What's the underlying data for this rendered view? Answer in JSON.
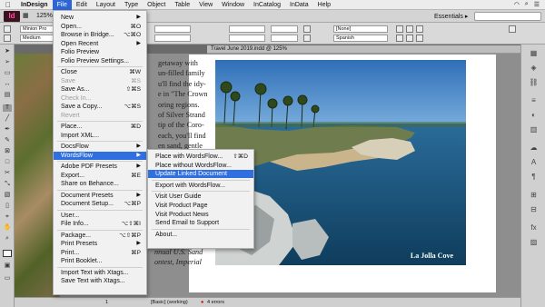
{
  "menubar": {
    "app": "InDesign",
    "items": [
      "File",
      "Edit",
      "Layout",
      "Type",
      "Object",
      "Table",
      "View",
      "Window",
      "InCatalog",
      "InData",
      "Help"
    ]
  },
  "appbar": {
    "logo": "Id",
    "zoom": "125%",
    "workspace": "Essentials ▸",
    "search_icon": "search-icon"
  },
  "control": {
    "font": "Minion Pro",
    "style": "Medium",
    "swatch": "[None]",
    "language": "Spanish"
  },
  "document": {
    "tab_title": "Travel June 2019.indd @ 125%",
    "body_lines": [
      "getaway with",
      "un-filled family",
      "u'll find the idy-",
      "e in \"The Crown",
      "oring regions.",
      "of Silver Strand",
      "tip of the Coro-",
      "each, you'll find",
      "en sand, gentle"
    ],
    "bottom_lines": [
      "nnual U.S. Sand",
      "ontest, Imperial"
    ],
    "photo_caption": "La Jolla Cove"
  },
  "status": {
    "page": "1",
    "preflight": "[Basic] (working)",
    "errors": "4 errors"
  },
  "file_menu": {
    "items": [
      {
        "label": "New",
        "shortcut": "",
        "arrow": true,
        "disabled": false
      },
      {
        "label": "Open...",
        "shortcut": "⌘O",
        "arrow": false,
        "disabled": false
      },
      {
        "label": "Browse in Bridge...",
        "shortcut": "⌥⌘O",
        "arrow": false,
        "disabled": false
      },
      {
        "label": "Open Recent",
        "shortcut": "",
        "arrow": true,
        "disabled": false
      },
      {
        "label": "Folio Preview",
        "shortcut": "",
        "arrow": false,
        "disabled": false
      },
      {
        "label": "Folio Preview Settings...",
        "shortcut": "",
        "arrow": false,
        "disabled": false
      },
      {
        "label": "Close",
        "shortcut": "⌘W",
        "arrow": false,
        "disabled": false
      },
      {
        "label": "Save",
        "shortcut": "⌘S",
        "arrow": false,
        "disabled": true
      },
      {
        "label": "Save As...",
        "shortcut": "⇧⌘S",
        "arrow": false,
        "disabled": false
      },
      {
        "label": "Check In...",
        "shortcut": "",
        "arrow": false,
        "disabled": true
      },
      {
        "label": "Save a Copy...",
        "shortcut": "⌥⌘S",
        "arrow": false,
        "disabled": false
      },
      {
        "label": "Revert",
        "shortcut": "",
        "arrow": false,
        "disabled": true
      },
      {
        "label": "Place...",
        "shortcut": "⌘D",
        "arrow": false,
        "disabled": false
      },
      {
        "label": "Import XML...",
        "shortcut": "",
        "arrow": false,
        "disabled": false
      },
      {
        "label": "DocsFlow",
        "shortcut": "",
        "arrow": true,
        "disabled": false
      },
      {
        "label": "WordsFlow",
        "shortcut": "",
        "arrow": true,
        "disabled": false
      },
      {
        "label": "Adobe PDF Presets",
        "shortcut": "",
        "arrow": true,
        "disabled": false
      },
      {
        "label": "Export...",
        "shortcut": "⌘E",
        "arrow": false,
        "disabled": false
      },
      {
        "label": "Share on Behance...",
        "shortcut": "",
        "arrow": false,
        "disabled": false
      },
      {
        "label": "Document Presets",
        "shortcut": "",
        "arrow": true,
        "disabled": false
      },
      {
        "label": "Document Setup...",
        "shortcut": "⌥⌘P",
        "arrow": false,
        "disabled": false
      },
      {
        "label": "User...",
        "shortcut": "",
        "arrow": false,
        "disabled": false
      },
      {
        "label": "File Info...",
        "shortcut": "⌥⇧⌘I",
        "arrow": false,
        "disabled": false
      },
      {
        "label": "Package...",
        "shortcut": "⌥⇧⌘P",
        "arrow": false,
        "disabled": false
      },
      {
        "label": "Print Presets",
        "shortcut": "",
        "arrow": true,
        "disabled": false
      },
      {
        "label": "Print...",
        "shortcut": "⌘P",
        "arrow": false,
        "disabled": false
      },
      {
        "label": "Print Booklet...",
        "shortcut": "",
        "arrow": false,
        "disabled": false
      },
      {
        "label": "Import Text with Xtags...",
        "shortcut": "",
        "arrow": false,
        "disabled": false
      },
      {
        "label": "Save Text with Xtags...",
        "shortcut": "",
        "arrow": false,
        "disabled": false
      }
    ]
  },
  "wordsflow_menu": {
    "items": [
      {
        "label": "Place with WordsFlow...",
        "shortcut": "⇧⌘D"
      },
      {
        "label": "Place without WordsFlow...",
        "shortcut": ""
      },
      {
        "label": "Update Linked Document",
        "shortcut": ""
      },
      {
        "label": "Export with WordsFlow...",
        "shortcut": ""
      },
      {
        "label": "Visit User Guide",
        "shortcut": ""
      },
      {
        "label": "Visit Product Page",
        "shortcut": ""
      },
      {
        "label": "Visit Product News",
        "shortcut": ""
      },
      {
        "label": "Send Email to Support",
        "shortcut": ""
      },
      {
        "label": "About...",
        "shortcut": ""
      }
    ]
  },
  "colors": {
    "menu_highlight": "#2f6fe0",
    "app_logo_bg": "#3b1320",
    "app_logo_fg": "#ff4fa0"
  }
}
